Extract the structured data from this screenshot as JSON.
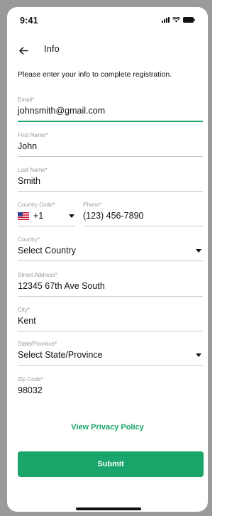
{
  "status_bar": {
    "time": "9:41"
  },
  "header": {
    "title": "Info"
  },
  "intro_text": "Please enter your info to complete registration.",
  "form": {
    "email": {
      "label": "Email*",
      "value": "johnsmith@gmail.com"
    },
    "first_name": {
      "label": "First Name*",
      "value": "John"
    },
    "last_name": {
      "label": "Last Name*",
      "value": "Smith"
    },
    "country_code": {
      "label": "Country Code*",
      "value": "+1"
    },
    "phone": {
      "label": "Phone*",
      "value": "(123) 456-7890"
    },
    "country": {
      "label": "Country*",
      "value": "Select Country"
    },
    "street_address": {
      "label": "Street Address*",
      "value": "12345 67th Ave South"
    },
    "city": {
      "label": "City*",
      "value": "Kent"
    },
    "state": {
      "label": "State/Province*",
      "value": "Select State/Province"
    },
    "zip": {
      "label": "Zip Code*",
      "value": "98032"
    }
  },
  "privacy_link": "View Privacy Policy",
  "submit_label": "Submit",
  "colors": {
    "accent": "#1aa66a",
    "divider": "#c9c9c9",
    "label": "#9a9a9a"
  }
}
